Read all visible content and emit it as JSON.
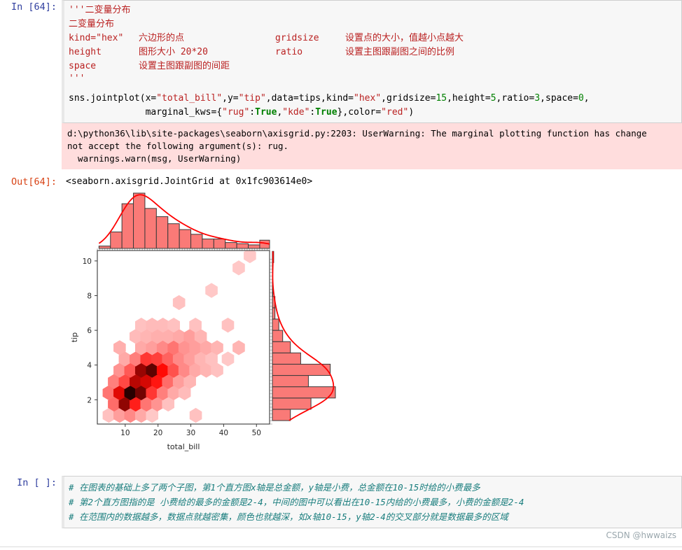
{
  "notebook": {
    "cell1": {
      "prompt": "In [64]:",
      "docstring_open": "'''二变量分布",
      "line_title": "二变量分布",
      "line_kind_key": "kind=\"hex\"",
      "line_kind_desc": "六边形的点",
      "line_gridsize_key": "gridsize",
      "line_gridsize_desc": "设置点的大小，值越小点越大",
      "line_height_key": "height",
      "line_height_desc": "图形大小 20*20",
      "line_ratio_key": "ratio",
      "line_ratio_desc": "设置主图跟副图之间的比例",
      "line_space_key": "space",
      "line_space_desc": "设置主图跟副图的间距",
      "docstring_close": "'''",
      "code_call_1": "sns.jointplot(x=",
      "arg_x": "\"total_bill\"",
      "arg_y": "\"tip\"",
      "arg_data": "data=tips,kind=",
      "arg_kind": "\"hex\"",
      "arg_gridsize_label": "gridsize=",
      "arg_gridsize_val": "15",
      "arg_height_label": "height=",
      "arg_height_val": "5",
      "arg_ratio_label": "ratio=",
      "arg_ratio_val": "3",
      "arg_space_label": "space=",
      "arg_space_val": "0",
      "code_call_2_indent": "              marginal_kws=",
      "arg_rug": "\"rug\"",
      "arg_true1": "True",
      "arg_kde": "\"kde\"",
      "arg_true2": "True",
      "arg_color_label": "color=",
      "arg_color_val": "\"red\""
    },
    "warning": {
      "line1": "d:\\python36\\lib\\site-packages\\seaborn\\axisgrid.py:2203: UserWarning: The marginal plotting function has change",
      "line2": "not accept the following argument(s): rug.",
      "line3": "  warnings.warn(msg, UserWarning)"
    },
    "output": {
      "prompt": "Out[64]:",
      "repr": "<seaborn.axisgrid.JointGrid at 0x1fc903614e0>"
    },
    "cell2": {
      "prompt": "In [ ]:",
      "comment1": "# 在图表的基础上多了两个子图，第1个直方图x轴是总金额，y轴是小费，总金额在10-15时给的小费最多",
      "comment2": "# 第2个直方图指的是 小费给的最多的金额是2-4，中间的图中可以看出在10-15内给的小费最多，小费的金额是2-4",
      "comment3": "# 在范围内的数据越多，数据点就越密集，颜色也就越深，如x轴10-15，y轴2-4的交叉部分就是数据最多的区域"
    },
    "watermark": "CSDN @hwwaizs"
  },
  "colors": {
    "accent_red": "#ff0000",
    "hist_fill": "#fa7a77",
    "hist_edge": "#3a3a3a",
    "warn_bg": "#ffdddd",
    "prompt_in": "#303F9F",
    "prompt_out": "#D84315",
    "comment_teal": "#197d7d"
  },
  "chart_data": {
    "type": "scatter",
    "plot_kind": "hexbin jointplot",
    "title": "",
    "xlabel": "total_bill",
    "ylabel": "tip",
    "xlim": [
      1.5,
      54
    ],
    "ylim": [
      0.6,
      10.6
    ],
    "xticks": [
      10,
      20,
      30,
      40,
      50
    ],
    "yticks": [
      2,
      4,
      6,
      8,
      10
    ],
    "grid": false,
    "legend": null,
    "gridsize": 15,
    "colormap": "white-to-dark-red",
    "top_marginal": {
      "type": "bar",
      "orientation": "vertical",
      "note": "histogram of total_bill with KDE and rug",
      "bin_edges": [
        2,
        5.5,
        9,
        12.5,
        16,
        19.5,
        23,
        26.5,
        30,
        33.5,
        37,
        40.5,
        44,
        47.5,
        51,
        54
      ],
      "counts": [
        2,
        14,
        38,
        47,
        34,
        27,
        21,
        16,
        12,
        8,
        8,
        5,
        4,
        3,
        7
      ]
    },
    "right_marginal": {
      "type": "bar",
      "orientation": "horizontal",
      "note": "histogram of tip with KDE and rug",
      "bin_edges": [
        0.8,
        1.45,
        2.1,
        2.75,
        3.4,
        4.05,
        4.7,
        5.35,
        6.0,
        6.65,
        7.3,
        7.95,
        8.6,
        9.25,
        9.9,
        10.55
      ],
      "counts": [
        14,
        30,
        49,
        28,
        45,
        22,
        14,
        8,
        5,
        2,
        2,
        0,
        0,
        0,
        1
      ]
    },
    "hexbins": [
      {
        "x": 5.0,
        "y": 1.1,
        "c": 0.06
      },
      {
        "x": 8.3,
        "y": 1.1,
        "c": 0.12
      },
      {
        "x": 11.6,
        "y": 1.1,
        "c": 0.16
      },
      {
        "x": 14.9,
        "y": 1.1,
        "c": 0.1
      },
      {
        "x": 18.2,
        "y": 1.1,
        "c": 0.05
      },
      {
        "x": 31.5,
        "y": 1.1,
        "c": 0.06
      },
      {
        "x": 6.6,
        "y": 1.75,
        "c": 0.22
      },
      {
        "x": 9.9,
        "y": 1.75,
        "c": 0.72
      },
      {
        "x": 13.2,
        "y": 1.75,
        "c": 0.4
      },
      {
        "x": 16.5,
        "y": 1.75,
        "c": 0.2
      },
      {
        "x": 19.8,
        "y": 1.75,
        "c": 0.14
      },
      {
        "x": 23.1,
        "y": 1.75,
        "c": 0.06
      },
      {
        "x": 5.0,
        "y": 2.4,
        "c": 0.2
      },
      {
        "x": 8.3,
        "y": 2.4,
        "c": 0.52
      },
      {
        "x": 11.6,
        "y": 2.4,
        "c": 1.0
      },
      {
        "x": 14.9,
        "y": 2.4,
        "c": 0.8
      },
      {
        "x": 18.2,
        "y": 2.4,
        "c": 0.34
      },
      {
        "x": 21.5,
        "y": 2.4,
        "c": 0.18
      },
      {
        "x": 24.8,
        "y": 2.4,
        "c": 0.1
      },
      {
        "x": 28.1,
        "y": 2.4,
        "c": 0.07
      },
      {
        "x": 6.6,
        "y": 3.05,
        "c": 0.18
      },
      {
        "x": 9.9,
        "y": 3.05,
        "c": 0.3
      },
      {
        "x": 13.2,
        "y": 3.05,
        "c": 0.62
      },
      {
        "x": 16.5,
        "y": 3.05,
        "c": 0.55
      },
      {
        "x": 19.8,
        "y": 3.05,
        "c": 0.42
      },
      {
        "x": 23.1,
        "y": 3.05,
        "c": 0.22
      },
      {
        "x": 26.4,
        "y": 3.05,
        "c": 0.12
      },
      {
        "x": 29.7,
        "y": 3.05,
        "c": 0.08
      },
      {
        "x": 8.3,
        "y": 3.7,
        "c": 0.14
      },
      {
        "x": 11.6,
        "y": 3.7,
        "c": 0.26
      },
      {
        "x": 14.9,
        "y": 3.7,
        "c": 0.7
      },
      {
        "x": 18.2,
        "y": 3.7,
        "c": 0.85
      },
      {
        "x": 21.5,
        "y": 3.7,
        "c": 0.45
      },
      {
        "x": 24.8,
        "y": 3.7,
        "c": 0.28
      },
      {
        "x": 28.1,
        "y": 3.7,
        "c": 0.16
      },
      {
        "x": 31.4,
        "y": 3.7,
        "c": 0.1
      },
      {
        "x": 34.7,
        "y": 3.7,
        "c": 0.08
      },
      {
        "x": 38.0,
        "y": 3.7,
        "c": 0.06
      },
      {
        "x": 9.9,
        "y": 4.35,
        "c": 0.1
      },
      {
        "x": 13.2,
        "y": 4.35,
        "c": 0.18
      },
      {
        "x": 16.5,
        "y": 4.35,
        "c": 0.34
      },
      {
        "x": 19.8,
        "y": 4.35,
        "c": 0.32
      },
      {
        "x": 23.1,
        "y": 4.35,
        "c": 0.24
      },
      {
        "x": 26.4,
        "y": 4.35,
        "c": 0.16
      },
      {
        "x": 29.7,
        "y": 4.35,
        "c": 0.12
      },
      {
        "x": 33.0,
        "y": 4.35,
        "c": 0.08
      },
      {
        "x": 36.3,
        "y": 4.35,
        "c": 0.06
      },
      {
        "x": 41.3,
        "y": 4.35,
        "c": 0.05
      },
      {
        "x": 8.3,
        "y": 5.0,
        "c": 0.09
      },
      {
        "x": 14.9,
        "y": 5.0,
        "c": 0.1
      },
      {
        "x": 18.2,
        "y": 5.0,
        "c": 0.12
      },
      {
        "x": 21.5,
        "y": 5.0,
        "c": 0.16
      },
      {
        "x": 24.8,
        "y": 5.0,
        "c": 0.2
      },
      {
        "x": 28.1,
        "y": 5.0,
        "c": 0.14
      },
      {
        "x": 31.4,
        "y": 5.0,
        "c": 0.12
      },
      {
        "x": 34.7,
        "y": 5.0,
        "c": 0.1
      },
      {
        "x": 38.0,
        "y": 5.0,
        "c": 0.08
      },
      {
        "x": 44.6,
        "y": 5.0,
        "c": 0.08
      },
      {
        "x": 13.2,
        "y": 5.65,
        "c": 0.07
      },
      {
        "x": 16.5,
        "y": 5.65,
        "c": 0.08
      },
      {
        "x": 19.8,
        "y": 5.65,
        "c": 0.09
      },
      {
        "x": 23.1,
        "y": 5.65,
        "c": 0.09
      },
      {
        "x": 26.4,
        "y": 5.65,
        "c": 0.1
      },
      {
        "x": 29.7,
        "y": 5.65,
        "c": 0.12
      },
      {
        "x": 33.0,
        "y": 5.65,
        "c": 0.08
      },
      {
        "x": 14.9,
        "y": 6.3,
        "c": 0.06
      },
      {
        "x": 18.2,
        "y": 6.3,
        "c": 0.07
      },
      {
        "x": 21.5,
        "y": 6.3,
        "c": 0.07
      },
      {
        "x": 24.8,
        "y": 6.3,
        "c": 0.06
      },
      {
        "x": 31.4,
        "y": 6.3,
        "c": 0.06
      },
      {
        "x": 41.3,
        "y": 6.3,
        "c": 0.06
      },
      {
        "x": 26.4,
        "y": 7.6,
        "c": 0.06
      },
      {
        "x": 36.3,
        "y": 8.3,
        "c": 0.05
      },
      {
        "x": 44.6,
        "y": 9.6,
        "c": 0.05
      },
      {
        "x": 48.0,
        "y": 10.3,
        "c": 0.05
      }
    ]
  }
}
